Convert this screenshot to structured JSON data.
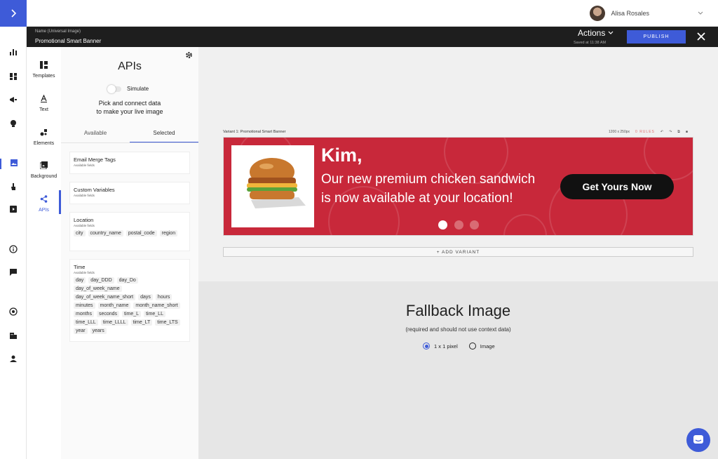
{
  "header": {
    "expand_icon": "chevron-right-icon",
    "user_name": "Alisa Rosales",
    "user_menu_icon": "chevron-down-icon"
  },
  "doc_bar": {
    "name_label": "Name (Universal Image)",
    "name": "Promotional Smart Banner",
    "actions_label": "Actions",
    "saved_text": "Saved at 11:38 AM",
    "publish_label": "PUBLISH",
    "close_icon": "close-icon"
  },
  "left_nav": {
    "icons": [
      "analytics-icon",
      "dashboard-icon",
      "campaign-icon",
      "lightbulb-icon",
      "image-icon",
      "touch-icon",
      "video-icon",
      "info-icon",
      "chat-icon",
      "target-icon",
      "building-icon",
      "person-icon"
    ]
  },
  "tools": {
    "items": [
      {
        "label": "Templates",
        "icon": "templates-icon"
      },
      {
        "label": "Text",
        "icon": "text-icon"
      },
      {
        "label": "Elements",
        "icon": "elements-icon"
      },
      {
        "label": "Background",
        "icon": "background-icon"
      },
      {
        "label": "APIs",
        "icon": "share-icon"
      }
    ],
    "selected": "APIs"
  },
  "panel": {
    "title": "APIs",
    "simulate_label": "Simulate",
    "instruction_line1": "Pick and connect data",
    "instruction_line2": "to make your live image",
    "tabs": [
      "Available",
      "Selected"
    ],
    "active_tab": "Selected",
    "cards": [
      {
        "title": "Email Merge Tags",
        "subtitle": "Available fields",
        "fields": []
      },
      {
        "title": "Custom Variables",
        "subtitle": "Available fields",
        "fields": []
      },
      {
        "title": "Location",
        "subtitle": "Available fields",
        "fields": [
          "city",
          "country_name",
          "postal_code",
          "region"
        ]
      },
      {
        "title": "Time",
        "subtitle": "Available fields",
        "fields": [
          "day",
          "day_DDD",
          "day_Do",
          "day_of_week_name",
          "day_of_week_name_short",
          "days",
          "hours",
          "minutes",
          "month_name",
          "month_name_short",
          "months",
          "seconds",
          "time_L",
          "time_LL",
          "time_LLL",
          "time_LLLL",
          "time_LT",
          "time_LTS",
          "year",
          "years"
        ]
      }
    ]
  },
  "canvas": {
    "variant_label": "Variant 1:",
    "variant_name": "Promotional Smart Banner",
    "size": "1200 x 250px",
    "rules": "0 RULES",
    "banner": {
      "name": "Kim,",
      "message": "Our new premium chicken sandwich is now available at your location!",
      "cta": "Get Yours Now",
      "background_color": "#c8283a",
      "dots_active": 1,
      "dots_total": 3
    },
    "add_variant_label": "+ ADD VARIANT"
  },
  "fallback": {
    "title": "Fallback Image",
    "subtitle": "(required and should not use context data)",
    "options": [
      "1 x 1 pixel",
      "Image"
    ],
    "selected": "1 x 1 pixel"
  },
  "colors": {
    "accent": "#3e5bd8",
    "dark_bar": "#1e1e1e",
    "banner": "#c8283a"
  }
}
